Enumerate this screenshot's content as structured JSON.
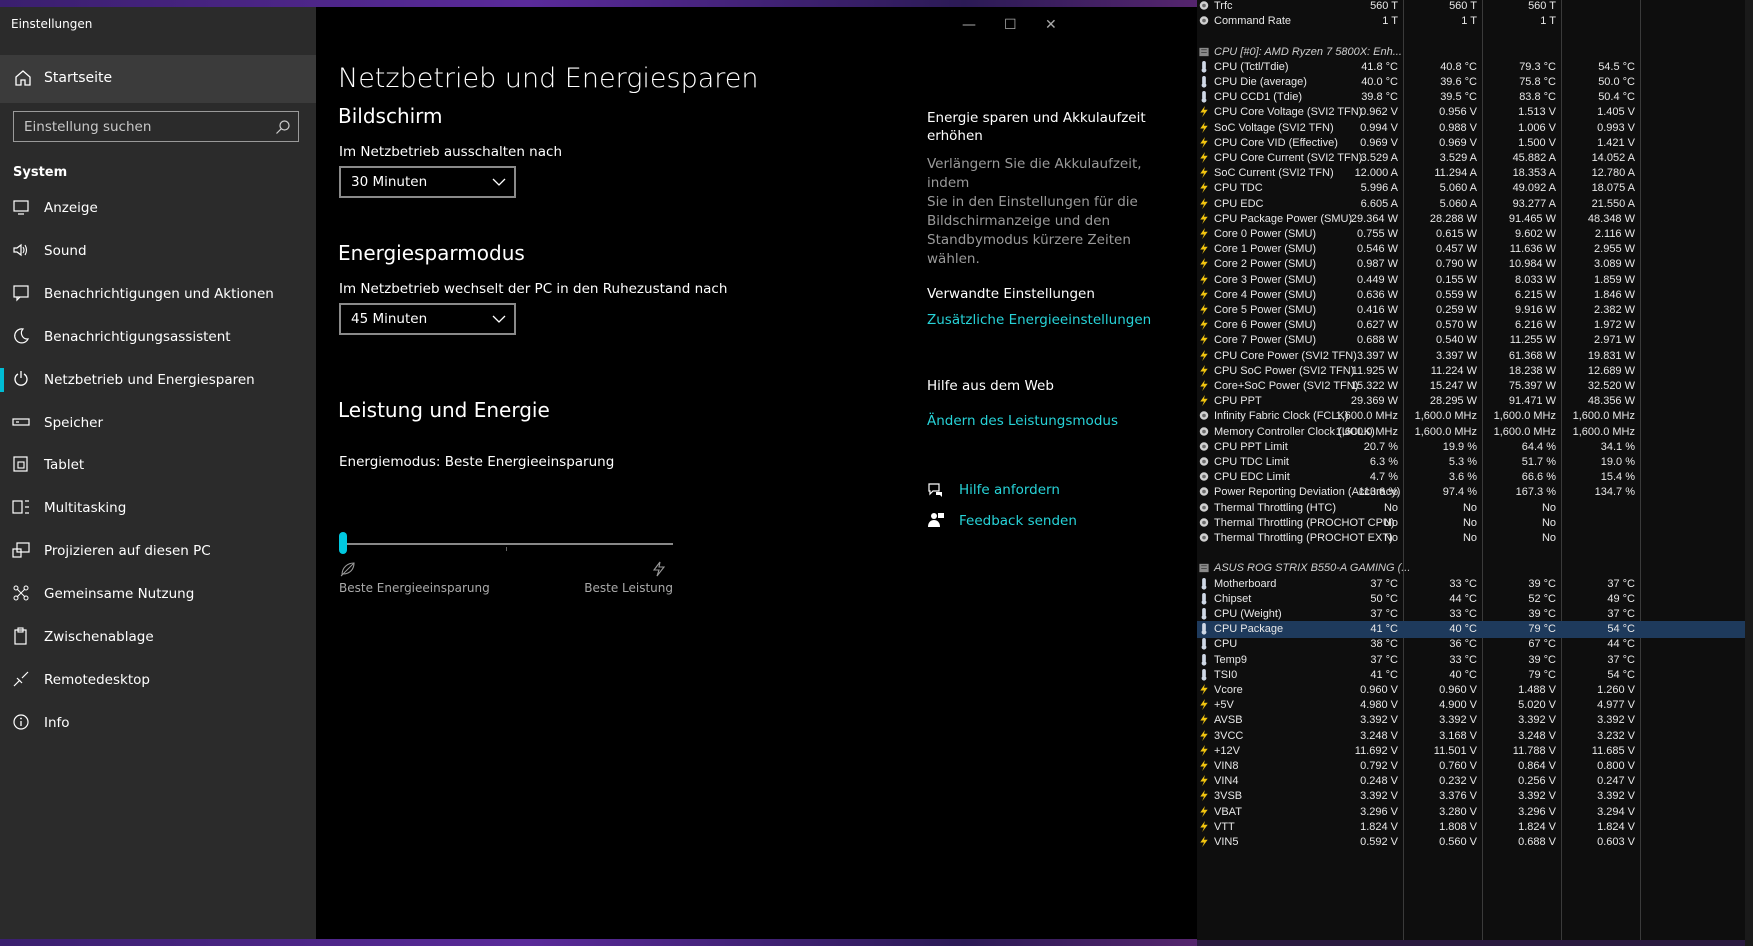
{
  "settings": {
    "app_title": "Einstellungen",
    "home_label": "Startseite",
    "search_placeholder": "Einstellung suchen",
    "section_label": "System",
    "nav": [
      {
        "label": "Anzeige",
        "icon": "monitor-icon"
      },
      {
        "label": "Sound",
        "icon": "speaker-icon"
      },
      {
        "label": "Benachrichtigungen und Aktionen",
        "icon": "notification-icon"
      },
      {
        "label": "Benachrichtigungsassistent",
        "icon": "moon-icon"
      },
      {
        "label": "Netzbetrieb und Energiesparen",
        "icon": "power-icon",
        "active": true
      },
      {
        "label": "Speicher",
        "icon": "storage-icon"
      },
      {
        "label": "Tablet",
        "icon": "tablet-icon"
      },
      {
        "label": "Multitasking",
        "icon": "multitasking-icon"
      },
      {
        "label": "Projizieren auf diesen PC",
        "icon": "project-icon"
      },
      {
        "label": "Gemeinsame Nutzung",
        "icon": "share-icon"
      },
      {
        "label": "Zwischenablage",
        "icon": "clipboard-icon"
      },
      {
        "label": "Remotedesktop",
        "icon": "remote-icon"
      },
      {
        "label": "Info",
        "icon": "info-icon"
      }
    ],
    "page_title": "Netzbetrieb und Energiesparen",
    "screen": {
      "heading": "Bildschirm",
      "label": "Im Netzbetrieb ausschalten nach",
      "value": "30 Minuten"
    },
    "sleep": {
      "heading": "Energiesparmodus",
      "label": "Im Netzbetrieb wechselt der PC in den Ruhezustand nach",
      "value": "45 Minuten"
    },
    "performance": {
      "heading": "Leistung und Energie",
      "mode_label": "Energiemodus: Beste Energieeinsparung",
      "slider_value": 0,
      "left_label": "Beste Energieeinsparung",
      "right_label": "Beste Leistung"
    },
    "side": {
      "tip_heading_1": "Energie sparen und Akkulaufzeit",
      "tip_heading_2": "erhöhen",
      "tip_text": [
        "Verlängern Sie die Akkulaufzeit, indem",
        "Sie in den Einstellungen für die",
        "Bildschirmanzeige und den",
        "Standbymodus kürzere Zeiten wählen."
      ],
      "related_heading": "Verwandte Einstellungen",
      "related_link": "Zusätzliche Energieeinstellungen",
      "web_heading": "Hilfe aus dem Web",
      "web_link": "Ändern des Leistungsmodus",
      "help_link": "Hilfe anfordern",
      "feedback_link": "Feedback senden"
    },
    "accent": "#27d3d8"
  },
  "hwinfo": {
    "rows": [
      {
        "type": "clock",
        "name": "Trfc",
        "v": [
          "560 T",
          "560 T",
          "560 T",
          ""
        ]
      },
      {
        "type": "clock",
        "name": "Command Rate",
        "v": [
          "1 T",
          "1 T",
          "1 T",
          ""
        ]
      },
      {
        "type": "blank"
      },
      {
        "type": "header",
        "name": "CPU [#0]: AMD Ryzen 7 5800X: Enh..."
      },
      {
        "type": "temp",
        "name": "CPU (Tctl/Tdie)",
        "v": [
          "41.8 °C",
          "40.8 °C",
          "79.3 °C",
          "54.5 °C"
        ]
      },
      {
        "type": "temp",
        "name": "CPU Die (average)",
        "v": [
          "40.0 °C",
          "39.6 °C",
          "75.8 °C",
          "50.0 °C"
        ]
      },
      {
        "type": "temp",
        "name": "CPU CCD1 (Tdie)",
        "v": [
          "39.8 °C",
          "39.5 °C",
          "83.8 °C",
          "50.4 °C"
        ]
      },
      {
        "type": "volt",
        "name": "CPU Core Voltage (SVI2 TFN)",
        "v": [
          "0.962 V",
          "0.956 V",
          "1.513 V",
          "1.405 V"
        ]
      },
      {
        "type": "volt",
        "name": "SoC Voltage (SVI2 TFN)",
        "v": [
          "0.994 V",
          "0.988 V",
          "1.006 V",
          "0.993 V"
        ]
      },
      {
        "type": "volt",
        "name": "CPU Core VID (Effective)",
        "v": [
          "0.969 V",
          "0.969 V",
          "1.500 V",
          "1.421 V"
        ]
      },
      {
        "type": "volt",
        "name": "CPU Core Current (SVI2 TFN)",
        "v": [
          "3.529 A",
          "3.529 A",
          "45.882 A",
          "14.052 A"
        ]
      },
      {
        "type": "volt",
        "name": "SoC Current (SVI2 TFN)",
        "v": [
          "12.000 A",
          "11.294 A",
          "18.353 A",
          "12.780 A"
        ]
      },
      {
        "type": "volt",
        "name": "CPU TDC",
        "v": [
          "5.996 A",
          "5.060 A",
          "49.092 A",
          "18.075 A"
        ]
      },
      {
        "type": "volt",
        "name": "CPU EDC",
        "v": [
          "6.605 A",
          "5.060 A",
          "93.277 A",
          "21.550 A"
        ]
      },
      {
        "type": "volt",
        "name": "CPU Package Power (SMU)",
        "v": [
          "29.364 W",
          "28.288 W",
          "91.465 W",
          "48.348 W"
        ]
      },
      {
        "type": "volt",
        "name": "Core 0 Power (SMU)",
        "v": [
          "0.755 W",
          "0.615 W",
          "9.602 W",
          "2.116 W"
        ]
      },
      {
        "type": "volt",
        "name": "Core 1 Power (SMU)",
        "v": [
          "0.546 W",
          "0.457 W",
          "11.636 W",
          "2.955 W"
        ]
      },
      {
        "type": "volt",
        "name": "Core 2 Power (SMU)",
        "v": [
          "0.987 W",
          "0.790 W",
          "10.984 W",
          "3.089 W"
        ]
      },
      {
        "type": "volt",
        "name": "Core 3 Power (SMU)",
        "v": [
          "0.449 W",
          "0.155 W",
          "8.033 W",
          "1.859 W"
        ]
      },
      {
        "type": "volt",
        "name": "Core 4 Power (SMU)",
        "v": [
          "0.636 W",
          "0.559 W",
          "6.215 W",
          "1.846 W"
        ]
      },
      {
        "type": "volt",
        "name": "Core 5 Power (SMU)",
        "v": [
          "0.416 W",
          "0.259 W",
          "9.916 W",
          "2.382 W"
        ]
      },
      {
        "type": "volt",
        "name": "Core 6 Power (SMU)",
        "v": [
          "0.627 W",
          "0.570 W",
          "6.216 W",
          "1.972 W"
        ]
      },
      {
        "type": "volt",
        "name": "Core 7 Power (SMU)",
        "v": [
          "0.688 W",
          "0.540 W",
          "11.255 W",
          "2.971 W"
        ]
      },
      {
        "type": "volt",
        "name": "CPU Core Power (SVI2 TFN)",
        "v": [
          "3.397 W",
          "3.397 W",
          "61.368 W",
          "19.831 W"
        ]
      },
      {
        "type": "volt",
        "name": "CPU SoC Power (SVI2 TFN)",
        "v": [
          "11.925 W",
          "11.224 W",
          "18.238 W",
          "12.689 W"
        ]
      },
      {
        "type": "volt",
        "name": "Core+SoC Power (SVI2 TFN)",
        "v": [
          "15.322 W",
          "15.247 W",
          "75.397 W",
          "32.520 W"
        ]
      },
      {
        "type": "volt",
        "name": "CPU PPT",
        "v": [
          "29.369 W",
          "28.295 W",
          "91.471 W",
          "48.356 W"
        ]
      },
      {
        "type": "clock",
        "name": "Infinity Fabric Clock (FCLK)",
        "v": [
          "1,600.0 MHz",
          "1,600.0 MHz",
          "1,600.0 MHz",
          "1,600.0 MHz"
        ]
      },
      {
        "type": "clock",
        "name": "Memory Controller Clock (UCLK)",
        "v": [
          "1,600.0 MHz",
          "1,600.0 MHz",
          "1,600.0 MHz",
          "1,600.0 MHz"
        ]
      },
      {
        "type": "clock",
        "name": "CPU PPT Limit",
        "v": [
          "20.7 %",
          "19.9 %",
          "64.4 %",
          "34.1 %"
        ]
      },
      {
        "type": "clock",
        "name": "CPU TDC Limit",
        "v": [
          "6.3 %",
          "5.3 %",
          "51.7 %",
          "19.0 %"
        ]
      },
      {
        "type": "clock",
        "name": "CPU EDC Limit",
        "v": [
          "4.7 %",
          "3.6 %",
          "66.6 %",
          "15.4 %"
        ]
      },
      {
        "type": "clock",
        "name": "Power Reporting Deviation (Accuracy)",
        "v": [
          "113.6 %",
          "97.4 %",
          "167.3 %",
          "134.7 %"
        ]
      },
      {
        "type": "clock",
        "name": "Thermal Throttling (HTC)",
        "v": [
          "No",
          "No",
          "No",
          ""
        ]
      },
      {
        "type": "clock",
        "name": "Thermal Throttling (PROCHOT CPU)",
        "v": [
          "No",
          "No",
          "No",
          ""
        ]
      },
      {
        "type": "clock",
        "name": "Thermal Throttling (PROCHOT EXT)",
        "v": [
          "No",
          "No",
          "No",
          ""
        ]
      },
      {
        "type": "blank"
      },
      {
        "type": "header",
        "name": "ASUS ROG STRIX B550-A GAMING (..."
      },
      {
        "type": "temp",
        "name": "Motherboard",
        "v": [
          "37 °C",
          "33 °C",
          "39 °C",
          "37 °C"
        ]
      },
      {
        "type": "temp",
        "name": "Chipset",
        "v": [
          "50 °C",
          "44 °C",
          "52 °C",
          "49 °C"
        ]
      },
      {
        "type": "temp",
        "name": "CPU (Weight)",
        "v": [
          "37 °C",
          "33 °C",
          "39 °C",
          "37 °C"
        ]
      },
      {
        "type": "temp",
        "name": "CPU Package",
        "v": [
          "41 °C",
          "40 °C",
          "79 °C",
          "54 °C"
        ],
        "selected": true
      },
      {
        "type": "temp",
        "name": "CPU",
        "v": [
          "38 °C",
          "36 °C",
          "67 °C",
          "44 °C"
        ]
      },
      {
        "type": "temp",
        "name": "Temp9",
        "v": [
          "37 °C",
          "33 °C",
          "39 °C",
          "37 °C"
        ]
      },
      {
        "type": "temp",
        "name": "TSI0",
        "v": [
          "41 °C",
          "40 °C",
          "79 °C",
          "54 °C"
        ]
      },
      {
        "type": "volt",
        "name": "Vcore",
        "v": [
          "0.960 V",
          "0.960 V",
          "1.488 V",
          "1.260 V"
        ]
      },
      {
        "type": "volt",
        "name": "+5V",
        "v": [
          "4.980 V",
          "4.900 V",
          "5.020 V",
          "4.977 V"
        ]
      },
      {
        "type": "volt",
        "name": "AVSB",
        "v": [
          "3.392 V",
          "3.392 V",
          "3.392 V",
          "3.392 V"
        ]
      },
      {
        "type": "volt",
        "name": "3VCC",
        "v": [
          "3.248 V",
          "3.168 V",
          "3.248 V",
          "3.232 V"
        ]
      },
      {
        "type": "volt",
        "name": "+12V",
        "v": [
          "11.692 V",
          "11.501 V",
          "11.788 V",
          "11.685 V"
        ]
      },
      {
        "type": "volt",
        "name": "VIN8",
        "v": [
          "0.792 V",
          "0.760 V",
          "0.864 V",
          "0.800 V"
        ]
      },
      {
        "type": "volt",
        "name": "VIN4",
        "v": [
          "0.248 V",
          "0.232 V",
          "0.256 V",
          "0.247 V"
        ]
      },
      {
        "type": "volt",
        "name": "3VSB",
        "v": [
          "3.392 V",
          "3.376 V",
          "3.392 V",
          "3.392 V"
        ]
      },
      {
        "type": "volt",
        "name": "VBAT",
        "v": [
          "3.296 V",
          "3.280 V",
          "3.296 V",
          "3.294 V"
        ]
      },
      {
        "type": "volt",
        "name": "VTT",
        "v": [
          "1.824 V",
          "1.808 V",
          "1.824 V",
          "1.824 V"
        ]
      },
      {
        "type": "volt",
        "name": "VIN5",
        "v": [
          "0.592 V",
          "0.560 V",
          "0.688 V",
          "0.603 V"
        ]
      }
    ]
  }
}
